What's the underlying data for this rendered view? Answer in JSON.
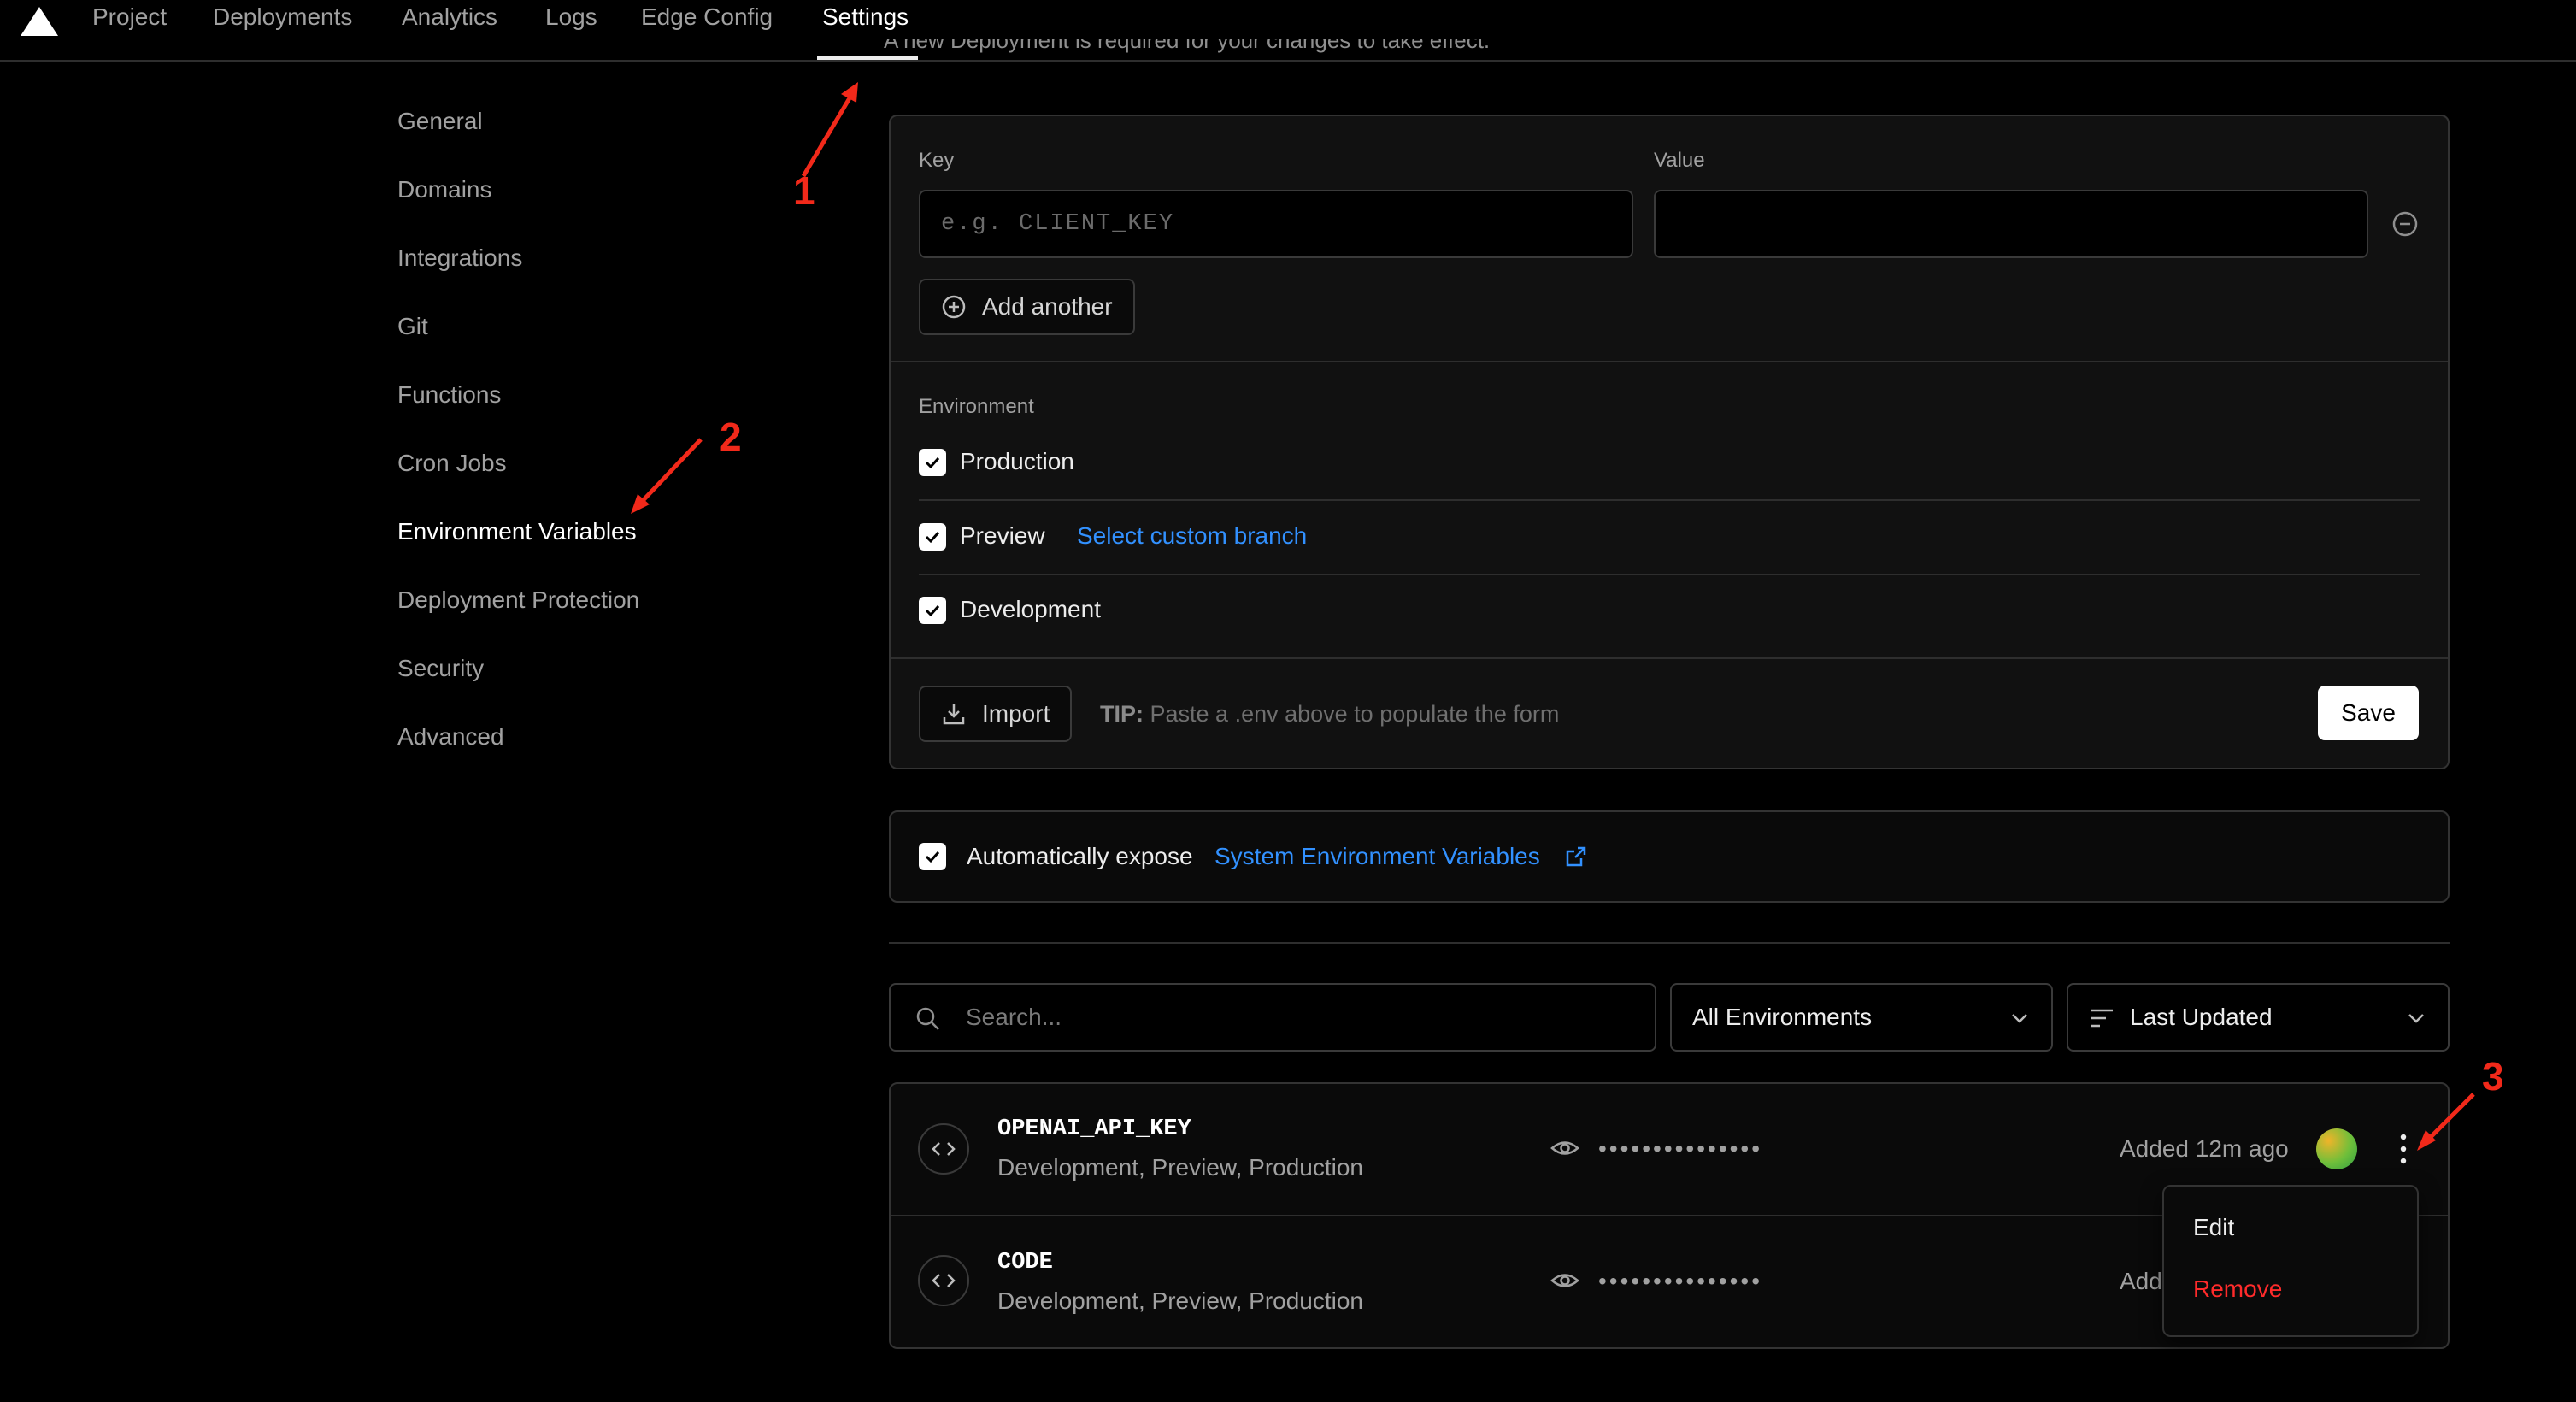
{
  "nav": {
    "tabs": [
      {
        "label": "Project"
      },
      {
        "label": "Deployments"
      },
      {
        "label": "Analytics"
      },
      {
        "label": "Logs"
      },
      {
        "label": "Edge Config"
      },
      {
        "label": "Settings",
        "active": true
      }
    ],
    "clipped_notice": "A new Deployment is required for your changes to take effect."
  },
  "sidebar": {
    "items": [
      {
        "label": "General"
      },
      {
        "label": "Domains"
      },
      {
        "label": "Integrations"
      },
      {
        "label": "Git"
      },
      {
        "label": "Functions"
      },
      {
        "label": "Cron Jobs"
      },
      {
        "label": "Environment Variables",
        "active": true
      },
      {
        "label": "Deployment Protection"
      },
      {
        "label": "Security"
      },
      {
        "label": "Advanced"
      }
    ]
  },
  "form": {
    "key_label": "Key",
    "key_placeholder": "e.g. CLIENT_KEY",
    "value_label": "Value",
    "value_value": "",
    "add_another_label": "Add another",
    "environment_label": "Environment",
    "environments": [
      {
        "label": "Production",
        "checked": true
      },
      {
        "label": "Preview",
        "checked": true,
        "link": "Select custom branch"
      },
      {
        "label": "Development",
        "checked": true
      }
    ],
    "import_label": "Import",
    "tip_prefix": "TIP:",
    "tip_text": "Paste a .env above to populate the form",
    "save_label": "Save"
  },
  "expose": {
    "checked": true,
    "text": "Automatically expose",
    "link": "System Environment Variables"
  },
  "filters": {
    "search_placeholder": "Search...",
    "environment_select": "All Environments",
    "sort_select": "Last Updated"
  },
  "variables": [
    {
      "name": "OPENAI_API_KEY",
      "envs": "Development, Preview, Production",
      "masked": "•••••••••••••••",
      "added": "Added 12m ago"
    },
    {
      "name": "CODE",
      "envs": "Development, Preview, Production",
      "masked": "•••••••••••••••",
      "added": "Added 12m ago"
    }
  ],
  "menu": {
    "items": [
      {
        "label": "Edit"
      },
      {
        "label": "Remove",
        "destructive": true
      }
    ]
  },
  "annotations": {
    "labels": [
      "1",
      "2",
      "3"
    ],
    "color": "#f2291a"
  },
  "colors": {
    "link": "#3291ff",
    "danger": "#ff2b2b",
    "background": "#000000"
  }
}
